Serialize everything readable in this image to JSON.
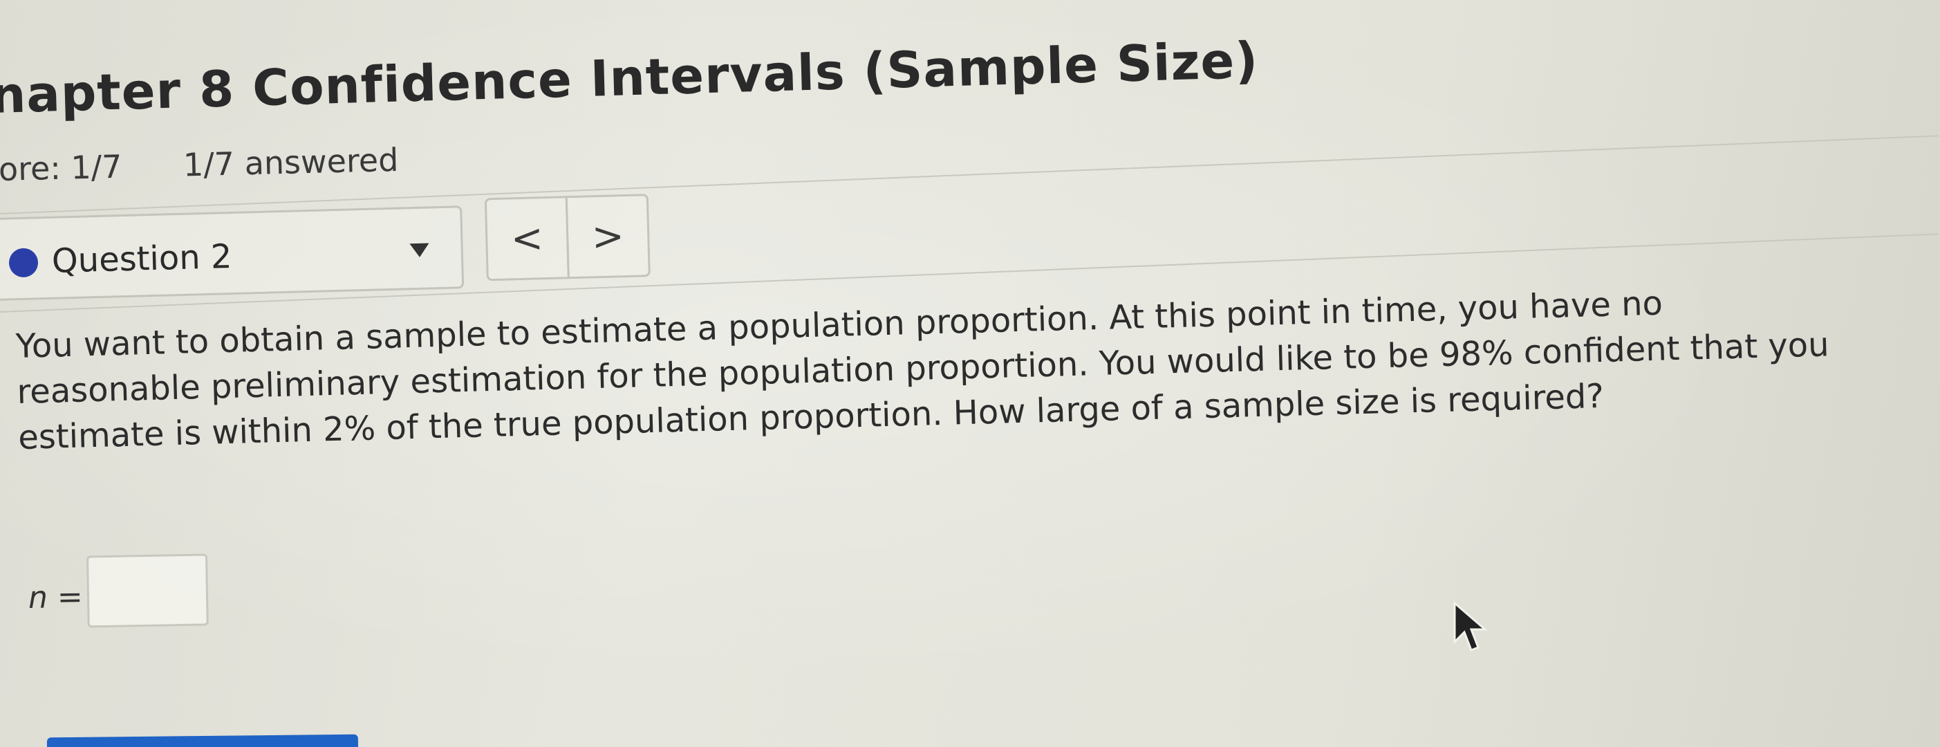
{
  "header": {
    "title": "napter 8 Confidence Intervals (Sample Size)",
    "score": "ore: 1/7",
    "answered": "1/7 answered"
  },
  "navigation": {
    "question_label": "Question 2",
    "status_color": "#2b3ea8",
    "prev_symbol": "<",
    "next_symbol": ">",
    "dropdown_icon": "triangle-down-icon"
  },
  "question": {
    "lines": [
      "You want to obtain a sample to estimate a population proportion. At this point in time, you have no",
      "reasonable preliminary estimation for the population proportion. You would like to be 98% confident that you",
      "estimate is within 2% of the true population proportion. How large of a sample size is required?"
    ]
  },
  "answer": {
    "label": "n =",
    "value": ""
  },
  "colors": {
    "accent": "#2b3ea8",
    "button_blue": "#1f63c6"
  },
  "icons": {
    "cursor": "mouse-pointer-icon"
  }
}
